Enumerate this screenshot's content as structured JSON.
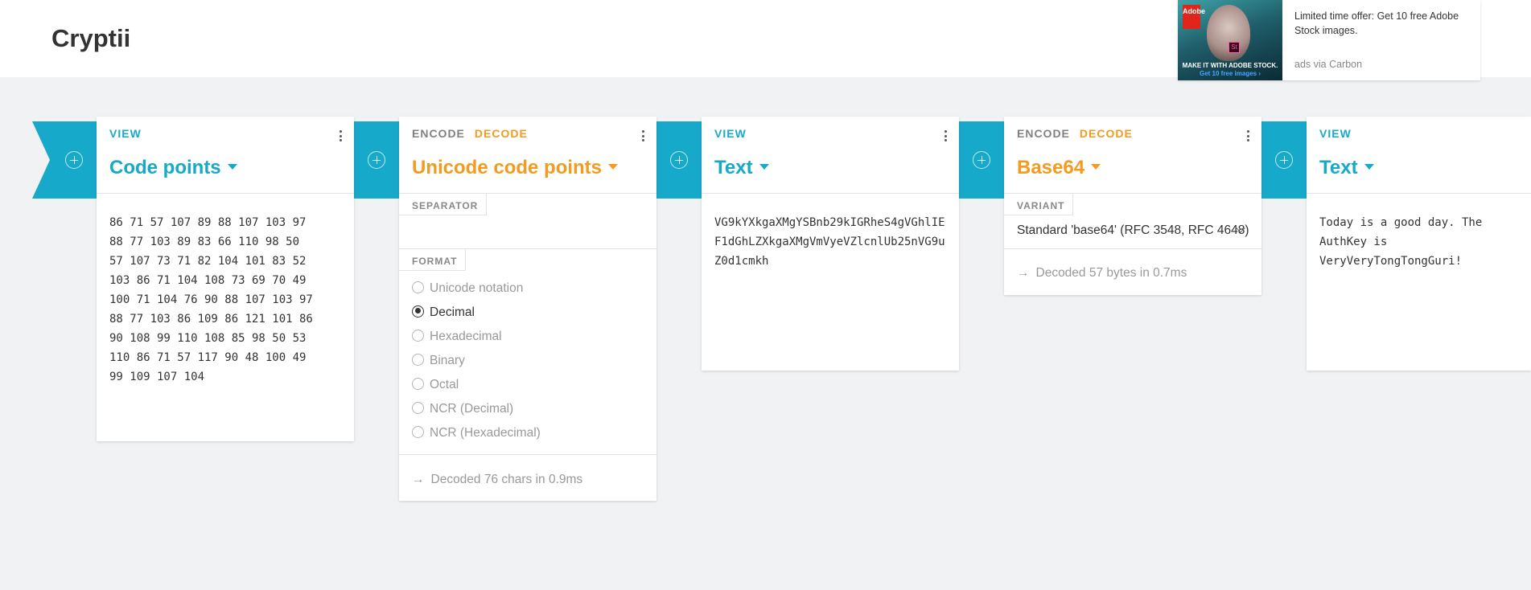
{
  "app": {
    "title": "Cryptii"
  },
  "ad": {
    "brand": "Adobe",
    "badge": "St",
    "image_tagline": "MAKE IT WITH ADOBE STOCK.",
    "image_cta": "Get 10 free images ›",
    "text": "Limited time offer: Get 10 free Adobe Stock images.",
    "via": "ads via Carbon"
  },
  "bricks": [
    {
      "tab": "VIEW",
      "title": "Code points",
      "content": "86 71 57 107 89 88 107 103 97\n88 77 103 89 83 66 110 98 50\n57 107 73 71 82 104 101 83 52\n103 86 71 104 108 73 69 70 49\n100 71 104 76 90 88 107 103 97\n88 77 103 86 109 86 121 101 86\n90 108 99 110 108 85 98 50 53\n110 86 71 57 117 90 48 100 49\n99 109 107 104"
    },
    {
      "tab_encode": "ENCODE",
      "tab_decode": "DECODE",
      "title": "Unicode code points",
      "separator_label": "SEPARATOR",
      "format_label": "FORMAT",
      "format_options": [
        "Unicode notation",
        "Decimal",
        "Hexadecimal",
        "Binary",
        "Octal",
        "NCR (Decimal)",
        "NCR (Hexadecimal)"
      ],
      "selected_format": "Decimal",
      "status": "Decoded 76 chars in 0.9ms"
    },
    {
      "tab": "VIEW",
      "title": "Text",
      "content": "VG9kYXkgaXMgYSBnb29kIGRheS4gVGhlIEF1dGhLZXkgaXMgVmVyeVZlcnlUb25nVG9uZ0d1cmkh"
    },
    {
      "tab_encode": "ENCODE",
      "tab_decode": "DECODE",
      "title": "Base64",
      "variant_label": "VARIANT",
      "variant_value": "Standard 'base64' (RFC 3548, RFC 4648)",
      "status": "Decoded 57 bytes in 0.7ms"
    },
    {
      "tab": "VIEW",
      "title": "Text",
      "content": "Today is a good day. The AuthKey is VeryVeryTongTongGuri!"
    }
  ],
  "colors": {
    "view_accent": "#16a9c9",
    "encoder_accent": "#f39a1f",
    "background": "#f1f2f4"
  }
}
